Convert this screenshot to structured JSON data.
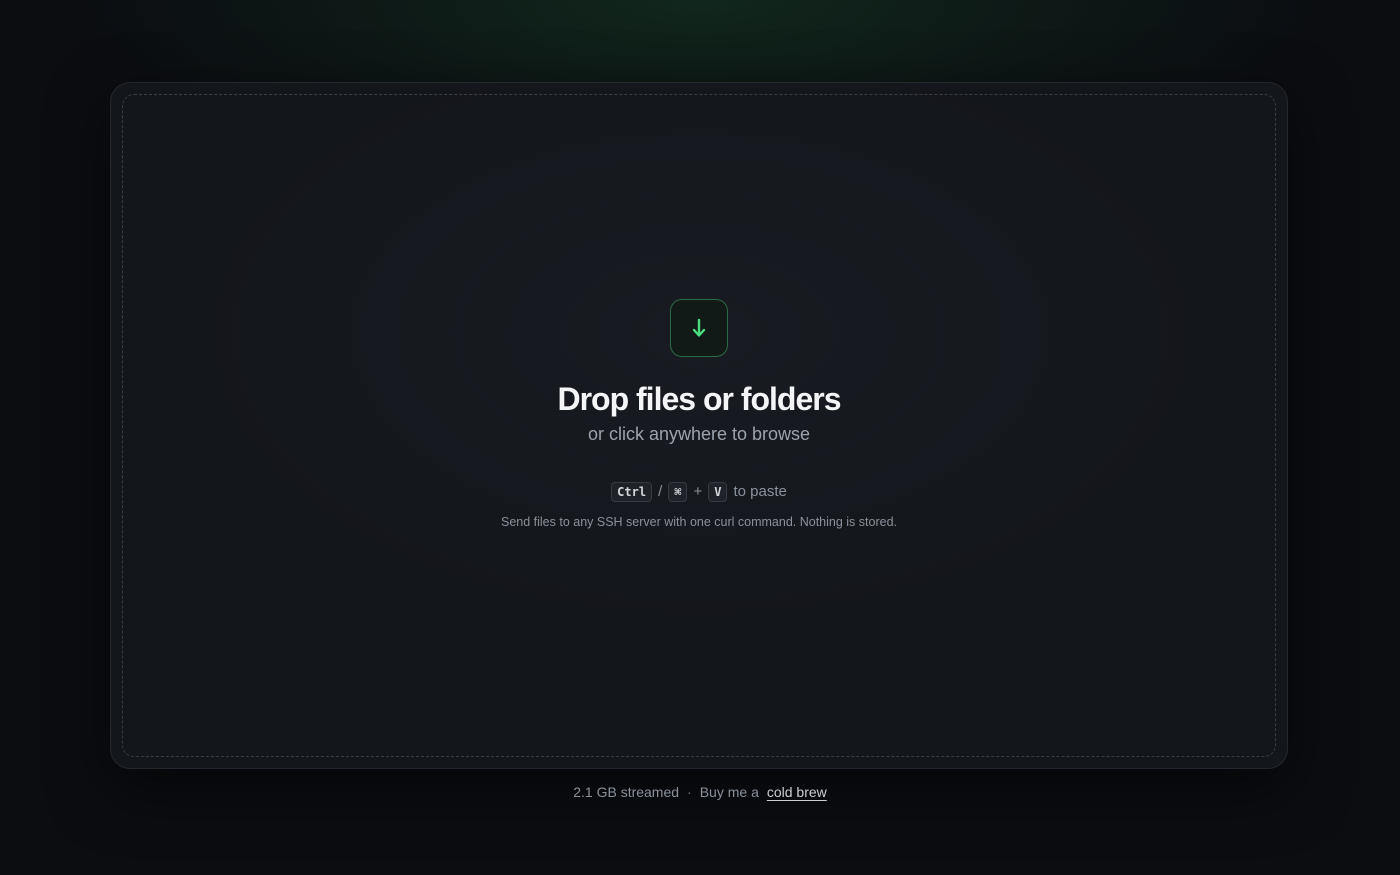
{
  "dropzone": {
    "icon": "arrow-down-icon",
    "headline": "Drop files or folders",
    "subline": "or click anywhere to browse",
    "paste_hint": {
      "key_ctrl": "Ctrl",
      "slash": "/",
      "key_cmd": "⌘",
      "plus": "+",
      "key_v": "V",
      "suffix": "to paste"
    },
    "tagline": "Send files to any SSH server with one curl command. Nothing is stored."
  },
  "footer": {
    "stat": "2.1 GB streamed",
    "separator": "·",
    "donate_prefix": "Buy me a",
    "donate_link": "cold brew"
  },
  "colors": {
    "accent": "#4ade80",
    "background": "#0b0d11",
    "card": "#13161b"
  }
}
